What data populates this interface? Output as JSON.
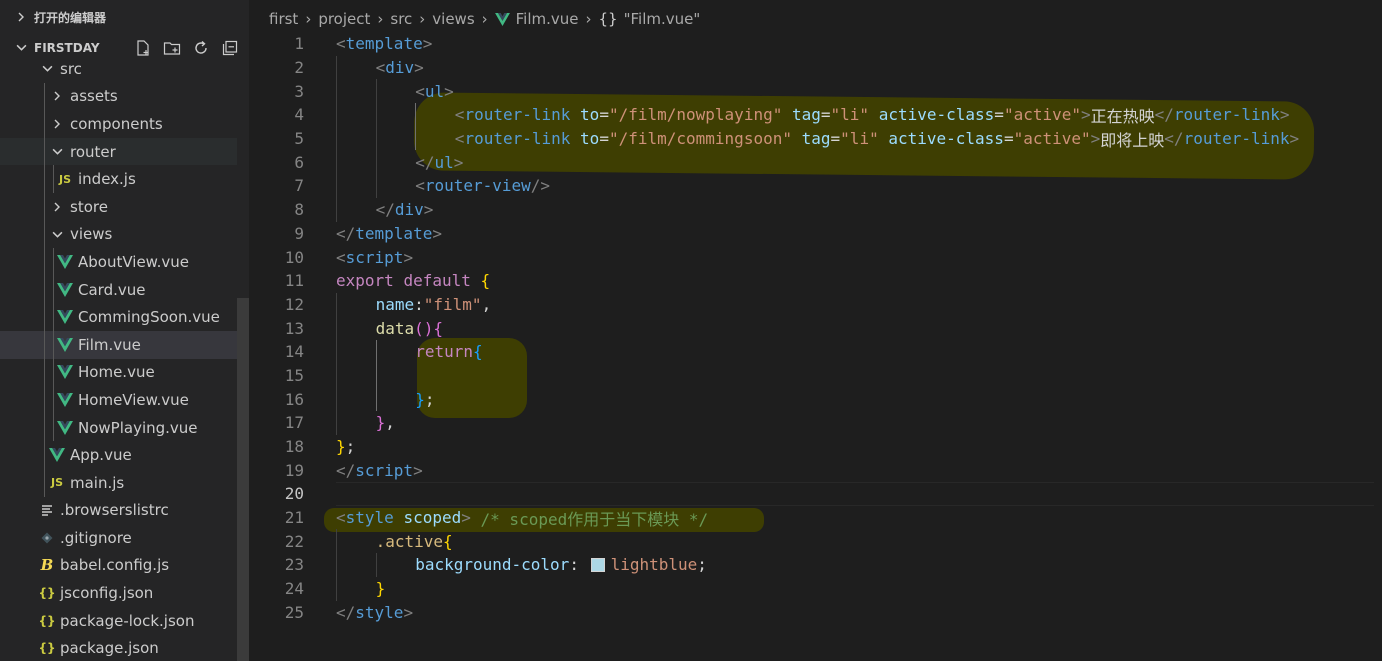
{
  "sidebar": {
    "open_editors_label": "打开的编辑器",
    "project_label": "FIRSTDAY",
    "actions": [
      "new-file-icon",
      "new-folder-icon",
      "refresh-icon",
      "collapse-all-icon"
    ],
    "tree": [
      {
        "label": "src",
        "type": "folder",
        "expanded": true,
        "depth": 1
      },
      {
        "label": "assets",
        "type": "folder",
        "expanded": false,
        "depth": 2
      },
      {
        "label": "components",
        "type": "folder",
        "expanded": false,
        "depth": 2
      },
      {
        "label": "router",
        "type": "folder",
        "expanded": true,
        "depth": 2
      },
      {
        "label": "index.js",
        "type": "js",
        "depth": 3
      },
      {
        "label": "store",
        "type": "folder",
        "expanded": false,
        "depth": 2
      },
      {
        "label": "views",
        "type": "folder",
        "expanded": true,
        "depth": 2
      },
      {
        "label": "AboutView.vue",
        "type": "vue",
        "depth": 3
      },
      {
        "label": "Card.vue",
        "type": "vue",
        "depth": 3
      },
      {
        "label": "CommingSoon.vue",
        "type": "vue",
        "depth": 3
      },
      {
        "label": "Film.vue",
        "type": "vue",
        "depth": 3,
        "selected": true
      },
      {
        "label": "Home.vue",
        "type": "vue",
        "depth": 3
      },
      {
        "label": "HomeView.vue",
        "type": "vue",
        "depth": 3
      },
      {
        "label": "NowPlaying.vue",
        "type": "vue",
        "depth": 3
      },
      {
        "label": "App.vue",
        "type": "vue",
        "depth": 2
      },
      {
        "label": "main.js",
        "type": "js",
        "depth": 2
      },
      {
        "label": ".browserslistrc",
        "type": "lines",
        "depth": 1
      },
      {
        "label": ".gitignore",
        "type": "git",
        "depth": 1
      },
      {
        "label": "babel.config.js",
        "type": "babel",
        "depth": 1
      },
      {
        "label": "jsconfig.json",
        "type": "json",
        "depth": 1
      },
      {
        "label": "package-lock.json",
        "type": "json",
        "depth": 1
      },
      {
        "label": "package.json",
        "type": "json",
        "depth": 1
      }
    ]
  },
  "breadcrumb": {
    "items": [
      "first",
      "project",
      "src",
      "views"
    ],
    "file": "Film.vue",
    "symbol": "\"Film.vue\"",
    "symbol_icon": "{}"
  },
  "editor": {
    "active_line": 20,
    "lines": [
      {
        "n": "1",
        "indent": 0,
        "tokens": [
          [
            "t-br",
            "<"
          ],
          [
            "t-tag",
            "template"
          ],
          [
            "t-br",
            ">"
          ]
        ]
      },
      {
        "n": "2",
        "indent": 1,
        "tokens": [
          [
            "t-br",
            "<"
          ],
          [
            "t-tag",
            "div"
          ],
          [
            "t-br",
            ">"
          ]
        ]
      },
      {
        "n": "3",
        "indent": 2,
        "tokens": [
          [
            "t-br",
            "<"
          ],
          [
            "t-tag",
            "ul"
          ],
          [
            "t-br",
            ">"
          ]
        ]
      },
      {
        "n": "4",
        "indent": 3,
        "tokens": [
          [
            "t-br",
            "<"
          ],
          [
            "t-tag",
            "router-link"
          ],
          [
            "t-txt",
            " "
          ],
          [
            "t-attr",
            "to"
          ],
          [
            "t-txt",
            "="
          ],
          [
            "t-str",
            "\"/film/nowplaying\""
          ],
          [
            "t-txt",
            " "
          ],
          [
            "t-attr",
            "tag"
          ],
          [
            "t-txt",
            "="
          ],
          [
            "t-str",
            "\"li\""
          ],
          [
            "t-txt",
            " "
          ],
          [
            "t-attr",
            "active-class"
          ],
          [
            "t-txt",
            "="
          ],
          [
            "t-str",
            "\"active\""
          ],
          [
            "t-br",
            ">"
          ],
          [
            "t-txt",
            "正在热映"
          ],
          [
            "t-br",
            "</"
          ],
          [
            "t-tag",
            "router-link"
          ],
          [
            "t-br",
            ">"
          ]
        ]
      },
      {
        "n": "5",
        "indent": 3,
        "tokens": [
          [
            "t-br",
            "<"
          ],
          [
            "t-tag",
            "router-link"
          ],
          [
            "t-txt",
            " "
          ],
          [
            "t-attr",
            "to"
          ],
          [
            "t-txt",
            "="
          ],
          [
            "t-str",
            "\"/film/commingsoon\""
          ],
          [
            "t-txt",
            " "
          ],
          [
            "t-attr",
            "tag"
          ],
          [
            "t-txt",
            "="
          ],
          [
            "t-str",
            "\"li\""
          ],
          [
            "t-txt",
            " "
          ],
          [
            "t-attr",
            "active-class"
          ],
          [
            "t-txt",
            "="
          ],
          [
            "t-str",
            "\"active\""
          ],
          [
            "t-br",
            ">"
          ],
          [
            "t-txt",
            "即将上映"
          ],
          [
            "t-br",
            "</"
          ],
          [
            "t-tag",
            "router-link"
          ],
          [
            "t-br",
            ">"
          ]
        ]
      },
      {
        "n": "6",
        "indent": 2,
        "tokens": [
          [
            "t-br",
            "</"
          ],
          [
            "t-tag",
            "ul"
          ],
          [
            "t-br",
            ">"
          ]
        ]
      },
      {
        "n": "7",
        "indent": 2,
        "tokens": [
          [
            "t-br",
            "<"
          ],
          [
            "t-tag",
            "router-view"
          ],
          [
            "t-br",
            "/>"
          ]
        ]
      },
      {
        "n": "8",
        "indent": 1,
        "tokens": [
          [
            "t-br",
            "</"
          ],
          [
            "t-tag",
            "div"
          ],
          [
            "t-br",
            ">"
          ]
        ]
      },
      {
        "n": "9",
        "indent": 0,
        "tokens": [
          [
            "t-br",
            "</"
          ],
          [
            "t-tag",
            "template"
          ],
          [
            "t-br",
            ">"
          ]
        ]
      },
      {
        "n": "10",
        "indent": 0,
        "tokens": [
          [
            "t-br",
            "<"
          ],
          [
            "t-tag",
            "script"
          ],
          [
            "t-br",
            ">"
          ]
        ]
      },
      {
        "n": "11",
        "indent": 0,
        "tokens": [
          [
            "t-kw",
            "export"
          ],
          [
            "t-txt",
            " "
          ],
          [
            "t-kw",
            "default"
          ],
          [
            "t-txt",
            " "
          ],
          [
            "t-y",
            "{"
          ]
        ]
      },
      {
        "n": "12",
        "indent": 1,
        "tokens": [
          [
            "t-attr",
            "name"
          ],
          [
            "t-txt",
            ":"
          ],
          [
            "t-str",
            "\"film\""
          ],
          [
            "t-txt",
            ","
          ]
        ]
      },
      {
        "n": "13",
        "indent": 1,
        "tokens": [
          [
            "t-fn",
            "data"
          ],
          [
            "t-p",
            "()"
          ],
          [
            "t-p",
            "{"
          ]
        ]
      },
      {
        "n": "14",
        "indent": 2,
        "tokens": [
          [
            "t-kw",
            "return"
          ],
          [
            "t-b",
            "{"
          ]
        ]
      },
      {
        "n": "15",
        "indent": 2,
        "tokens": []
      },
      {
        "n": "16",
        "indent": 2,
        "tokens": [
          [
            "t-b",
            "}"
          ],
          [
            "t-txt",
            ";"
          ]
        ]
      },
      {
        "n": "17",
        "indent": 1,
        "tokens": [
          [
            "t-p",
            "}"
          ],
          [
            "t-txt",
            ","
          ]
        ]
      },
      {
        "n": "18",
        "indent": 0,
        "tokens": [
          [
            "t-y",
            "}"
          ],
          [
            "t-txt",
            ";"
          ]
        ]
      },
      {
        "n": "19",
        "indent": 0,
        "tokens": [
          [
            "t-br",
            "</"
          ],
          [
            "t-tag",
            "script"
          ],
          [
            "t-br",
            ">"
          ]
        ]
      },
      {
        "n": "20",
        "indent": 0,
        "tokens": []
      },
      {
        "n": "21",
        "indent": 0,
        "tokens": [
          [
            "t-br",
            "<"
          ],
          [
            "t-tag",
            "style"
          ],
          [
            "t-txt",
            " "
          ],
          [
            "t-attr",
            "scoped"
          ],
          [
            "t-br",
            ">"
          ],
          [
            "t-txt",
            " "
          ],
          [
            "t-cm",
            "/* scoped作用于当下模块 */"
          ]
        ]
      },
      {
        "n": "22",
        "indent": 1,
        "tokens": [
          [
            "t-sel",
            ".active"
          ],
          [
            "t-y",
            "{"
          ]
        ]
      },
      {
        "n": "23",
        "indent": 2,
        "tokens": [
          [
            "t-prop",
            "background-color"
          ],
          [
            "t-txt",
            ": "
          ],
          [
            "swatch",
            ""
          ],
          [
            "t-str",
            "lightblue"
          ],
          [
            "t-txt",
            ";"
          ]
        ]
      },
      {
        "n": "24",
        "indent": 1,
        "tokens": [
          [
            "t-y",
            "}"
          ]
        ]
      },
      {
        "n": "25",
        "indent": 0,
        "tokens": [
          [
            "t-br",
            "</"
          ],
          [
            "t-tag",
            "style"
          ],
          [
            "t-br",
            ">"
          ]
        ]
      }
    ]
  },
  "colors": {
    "editor_bg": "#1e1e1e",
    "sidebar_bg": "#252526",
    "selected_row": "#37373d",
    "vue_icon": "#41b883",
    "js_icon": "#cbcb41",
    "json_icon": "#cbcb41",
    "highlight": "#414100"
  }
}
